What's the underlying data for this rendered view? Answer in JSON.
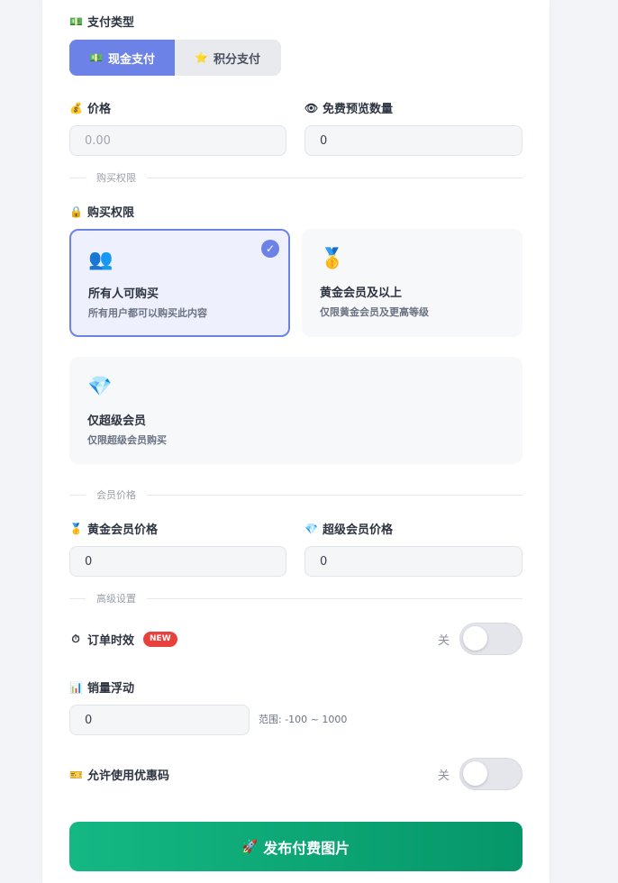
{
  "payment_type": {
    "label": "支付类型",
    "label_icon": "💵",
    "options": [
      {
        "icon": "💵",
        "label": "现金支付",
        "active": true
      },
      {
        "icon": "⭐",
        "label": "积分支付",
        "active": false
      }
    ]
  },
  "price": {
    "label": "价格",
    "icon": "💰",
    "placeholder": "0.00"
  },
  "preview_count": {
    "label": "免费预览数量",
    "icon": "👁",
    "value": "0"
  },
  "purchase_permission": {
    "divider": "购买权限",
    "label": "购买权限",
    "icon": "🔒",
    "options": [
      {
        "emoji": "👥",
        "title": "所有人可购买",
        "desc": "所有用户都可以购买此内容",
        "selected": true
      },
      {
        "emoji": "🥇",
        "title": "黄金会员及以上",
        "desc": "仅限黄金会员及更高等级",
        "selected": false
      },
      {
        "emoji": "💎",
        "title": "仅超级会员",
        "desc": "仅限超级会员购买",
        "selected": false
      }
    ],
    "check_icon": "✓"
  },
  "member_price": {
    "divider": "会员价格",
    "gold": {
      "label": "黄金会员价格",
      "icon": "🥇",
      "value": "0"
    },
    "super": {
      "label": "超级会员价格",
      "icon": "💎",
      "value": "0"
    }
  },
  "advanced": {
    "divider": "高级设置",
    "order_timing": {
      "label": "订单时效",
      "icon": "⏱",
      "badge": "NEW",
      "state": "关",
      "on": false
    },
    "sales_float": {
      "label": "销量浮动",
      "icon": "📊",
      "value": "0",
      "range_note": "范围: -100 ~ 1000"
    },
    "coupon": {
      "label": "允许使用优惠码",
      "icon": "🎫",
      "state": "关",
      "on": false
    }
  },
  "publish": {
    "icon": "🚀",
    "label": "发布付费图片"
  },
  "colors": {
    "accent": "#6d82e6",
    "publish_start": "#14b883",
    "publish_end": "#069669",
    "badge": "#e8403c"
  }
}
